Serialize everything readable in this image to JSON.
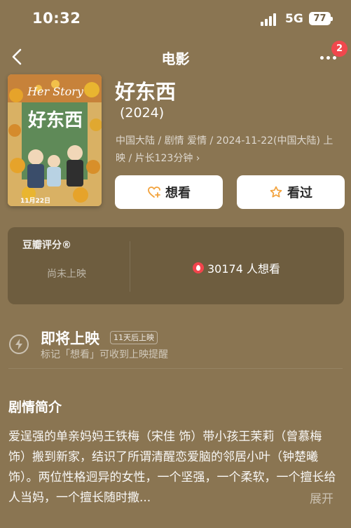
{
  "status_bar": {
    "time": "10:32",
    "network": "5G",
    "battery": "77"
  },
  "nav": {
    "title": "电影",
    "notification_count": "2"
  },
  "movie": {
    "title": "好东西",
    "year": "(2024)",
    "meta": "中国大陆 / 剧情 爱情 / 2024-11-22(中国大陆) 上映 / 片长123分钟 ›",
    "poster": {
      "title_text": "好东西",
      "english_text": "Her Story",
      "date_text": "11月22日"
    }
  },
  "actions": {
    "want_label": "想看",
    "seen_label": "看过"
  },
  "rating": {
    "label": "豆瓣评分®",
    "status": "尚未上映",
    "want_count_text": "30174 人想看"
  },
  "upcoming": {
    "title": "即将上映",
    "tag": "11天后上映",
    "subtitle": "标记「想看」可收到上映提醒"
  },
  "synopsis": {
    "heading": "剧情简介",
    "text": "爱逞强的单亲妈妈王铁梅（宋佳 饰）带小孩王茉莉（曾慕梅 饰）搬到新家，结识了所谓清醒恋爱脑的邻居小叶（钟楚曦 饰）。两位性格迥异的女性，一个坚强，一个柔软，一个擅长给人当妈，一个擅长随时撒...",
    "expand_label": "展开"
  },
  "colors": {
    "background": "#8a7552",
    "badge": "#f0484d",
    "want_icon": "#f2a23c",
    "seen_icon": "#f2a23c"
  }
}
